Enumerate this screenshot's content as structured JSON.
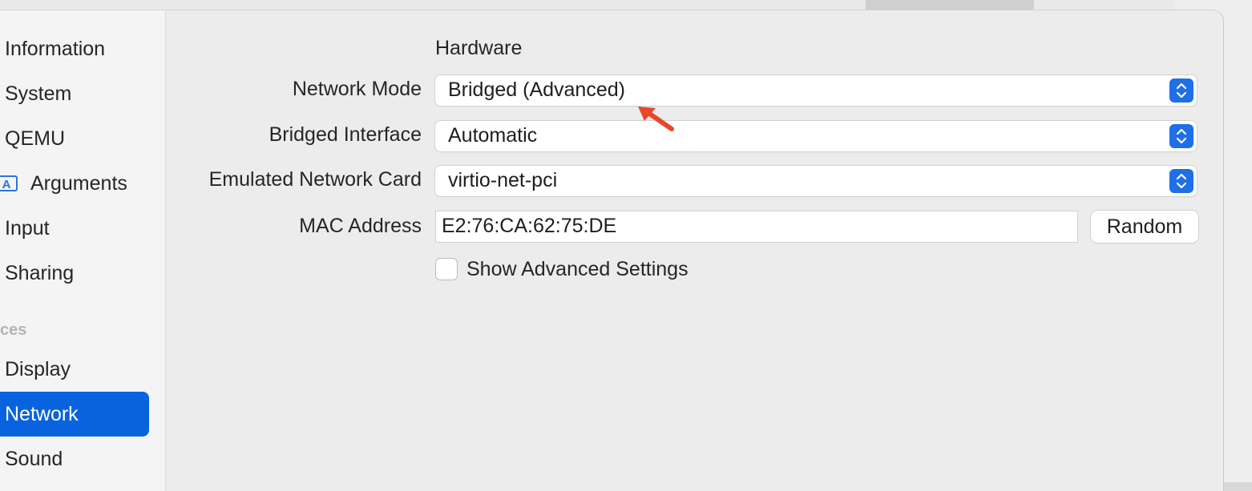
{
  "sidebar": {
    "items": [
      {
        "label": "Information"
      },
      {
        "label": "System"
      },
      {
        "label": "QEMU"
      },
      {
        "label": "Arguments",
        "icon": "arguments-icon",
        "icon_glyph": "A"
      },
      {
        "label": "Input"
      },
      {
        "label": "Sharing"
      },
      {
        "label": "Display"
      },
      {
        "label": "Network",
        "selected": true
      },
      {
        "label": "Sound"
      }
    ],
    "section_heading": "ces"
  },
  "network": {
    "section_title": "Hardware",
    "network_mode": {
      "label": "Network Mode",
      "value": "Bridged (Advanced)"
    },
    "bridged_interface": {
      "label": "Bridged Interface",
      "value": "Automatic"
    },
    "network_card": {
      "label": "Emulated Network Card",
      "value": "virtio-net-pci"
    },
    "mac_address": {
      "label": "MAC Address",
      "value": "E2:76:CA:62:75:DE",
      "random_button": "Random"
    },
    "advanced_settings": {
      "label": "Show Advanced Settings",
      "checked": false
    }
  },
  "colors": {
    "accent": "#0a63de",
    "stepper": "#1f6fe5",
    "annotation_arrow": "#e8472b"
  }
}
